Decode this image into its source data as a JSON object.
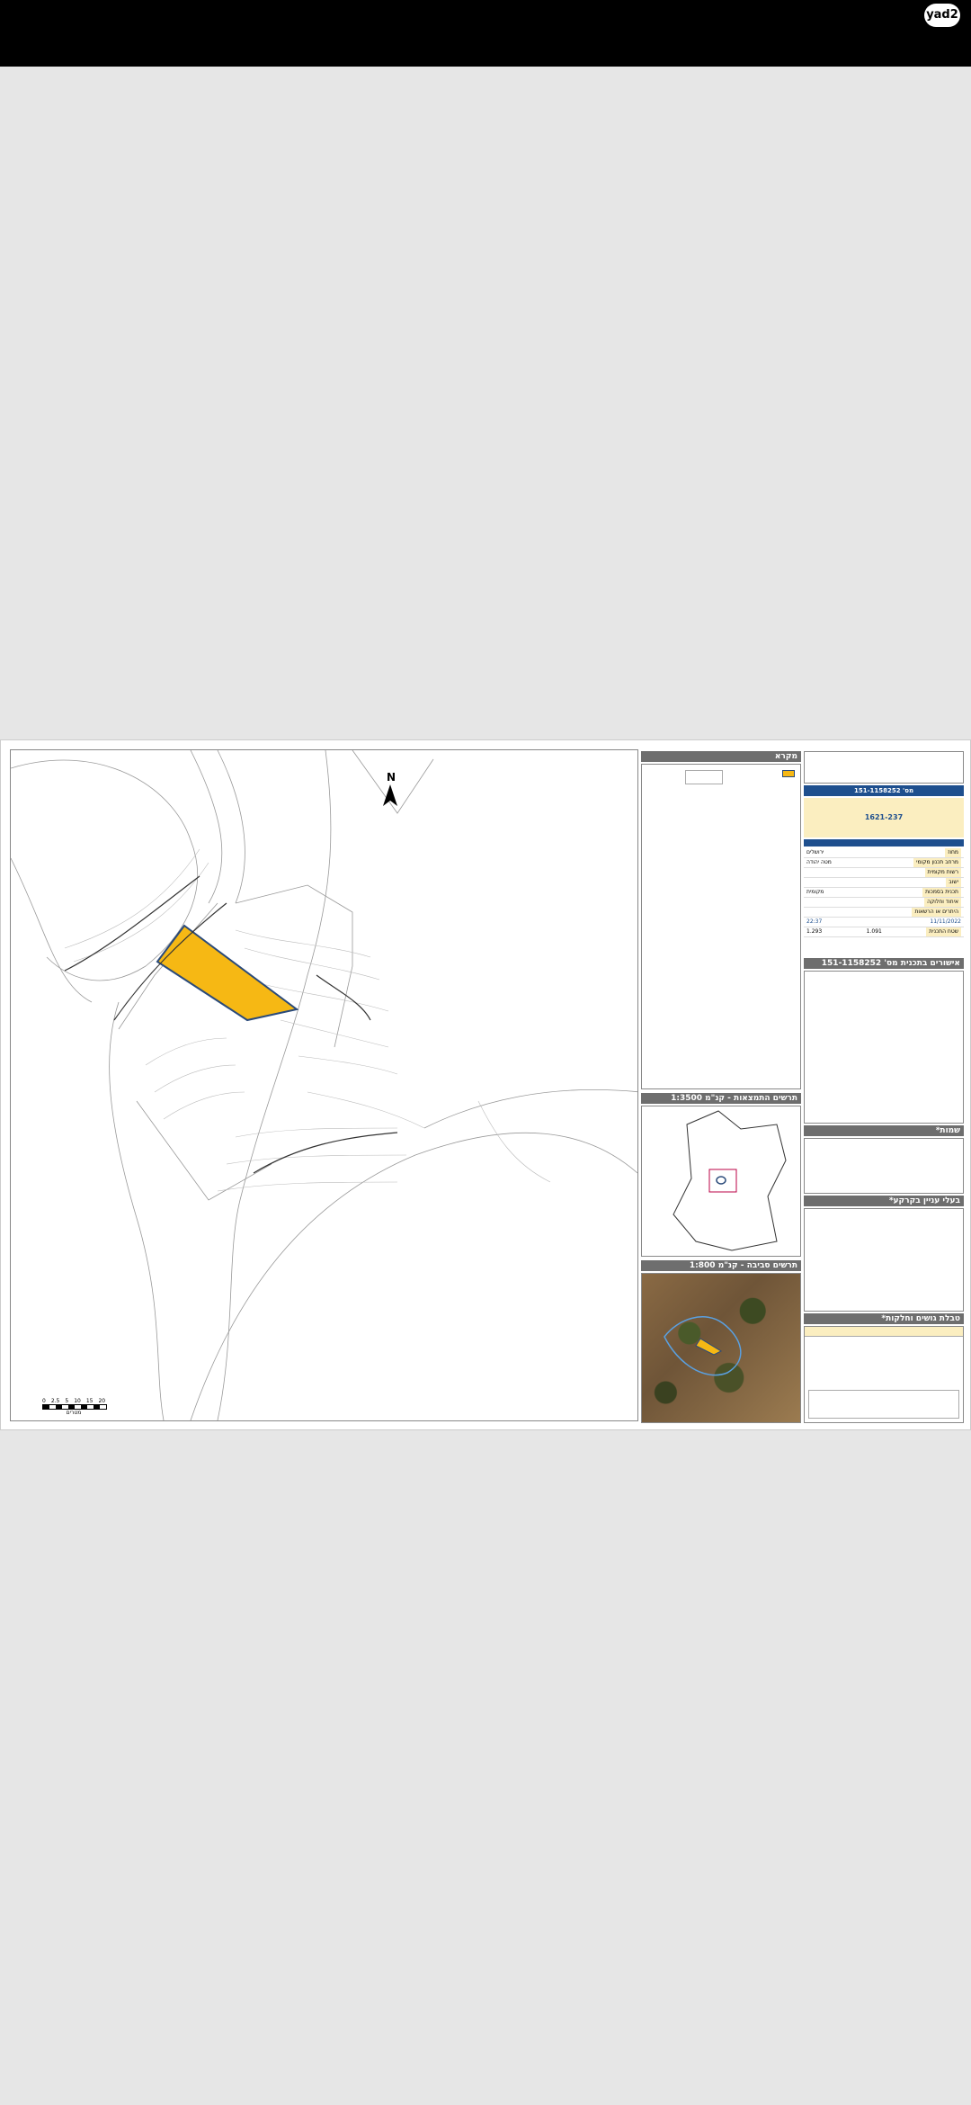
{
  "app": {
    "logo_text": "yad2"
  },
  "map": {
    "north_label": "N",
    "scale_ticks": [
      "0",
      "2.5",
      "5",
      "10",
      "15",
      "20"
    ],
    "scale_unit": "מטרים"
  },
  "legend": {
    "title": "מקרא"
  },
  "inset_location": {
    "title": "תרשים התמצאות - קנ\"מ 1:3500"
  },
  "inset_aerial": {
    "title": "תרשים סביבה - קנ\"מ 1:800"
  },
  "title_block": {
    "plan_number": "מס' 151-1158252",
    "plot_label": "1621-237",
    "rows": [
      {
        "label": "מחוז",
        "value": "ירושלים"
      },
      {
        "label": "מרחב תכנון מקומי",
        "value": "מטה יהודה"
      },
      {
        "label": "רשות מקומית",
        "value": ""
      },
      {
        "label": "ישוב",
        "value": ""
      },
      {
        "label": "תכנית בסמכות",
        "value": "מקומית"
      },
      {
        "label": "איחוד וחלוקה",
        "value": ""
      },
      {
        "label": "היתרים או הרשאות",
        "value": ""
      }
    ],
    "date": "11/11/2022",
    "time": "22:37",
    "area_label": "שטח התכנית",
    "area_value": "1.091",
    "area_value2": "1.293",
    "approvals_title": "אישורים בתכנית מס' 151-1158252",
    "names_title": "שמות*",
    "owners_title": "בעלי עניין בקרקע*",
    "table_title": "טבלת גושים וחלקות*"
  }
}
